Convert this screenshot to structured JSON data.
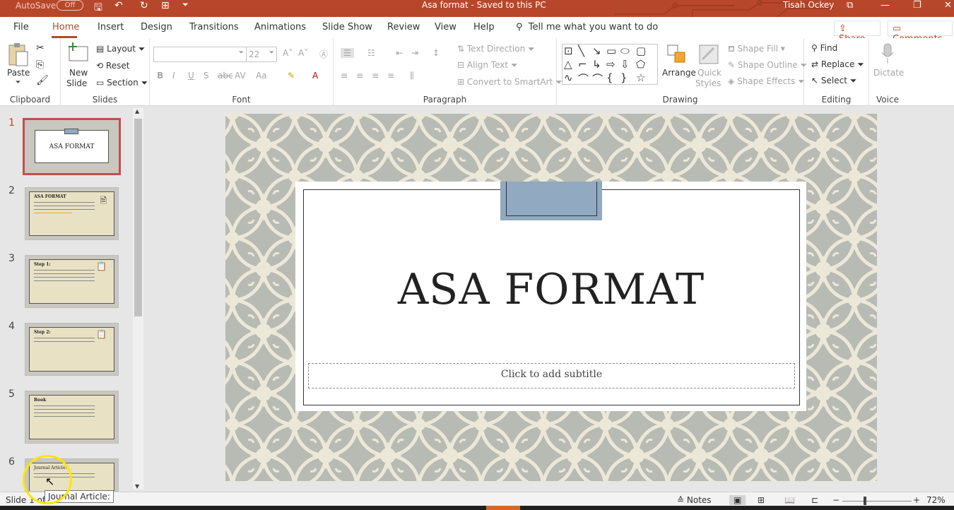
{
  "titlebar": {
    "autosave_label": "AutoSave",
    "autosave_state": "Off",
    "doc_title": "Asa format  -  Saved to this PC",
    "user": "Tisah Ockey"
  },
  "tabs": [
    "File",
    "Home",
    "Insert",
    "Design",
    "Transitions",
    "Animations",
    "Slide Show",
    "Review",
    "View",
    "Help"
  ],
  "active_tab": "Home",
  "tell_me": "Tell me what you want to do",
  "share": "Share",
  "comments": "Comments",
  "ribbon": {
    "clipboard": {
      "label": "Clipboard",
      "paste": "Paste"
    },
    "slides": {
      "label": "Slides",
      "new_slide_1": "New",
      "new_slide_2": "Slide",
      "layout": "Layout",
      "reset": "Reset",
      "section": "Section"
    },
    "font": {
      "label": "Font",
      "size": "22"
    },
    "paragraph": {
      "label": "Paragraph",
      "text_direction": "Text Direction",
      "align_text": "Align Text",
      "convert_smartart": "Convert to SmartArt"
    },
    "drawing": {
      "label": "Drawing",
      "arrange": "Arrange",
      "quick_styles_1": "Quick",
      "quick_styles_2": "Styles",
      "shape_fill": "Shape Fill",
      "shape_outline": "Shape Outline",
      "shape_effects": "Shape Effects"
    },
    "editing": {
      "label": "Editing",
      "find": "Find",
      "replace": "Replace",
      "select": "Select"
    },
    "voice": {
      "label": "Voice",
      "dictate": "Dictate"
    }
  },
  "thumbnails": [
    {
      "num": "1",
      "title": "ASA FORMAT"
    },
    {
      "num": "2",
      "title": "ASA FORMAT"
    },
    {
      "num": "3",
      "title": "Step 1:"
    },
    {
      "num": "4",
      "title": "Step 2:"
    },
    {
      "num": "5",
      "title": "Book"
    },
    {
      "num": "6",
      "title": "Journal Article:"
    }
  ],
  "slide": {
    "title": "ASA FORMAT",
    "subtitle_placeholder": "Click to add subtitle"
  },
  "status": {
    "slide_info": "Slide 1 of 6",
    "tooltip": "Journal Article:",
    "notes": "Notes",
    "zoom": "72%"
  },
  "colors": {
    "accent": "#b7472a",
    "slide_pattern": "#b8bbb4",
    "tab_shape": "#91a9c1"
  }
}
